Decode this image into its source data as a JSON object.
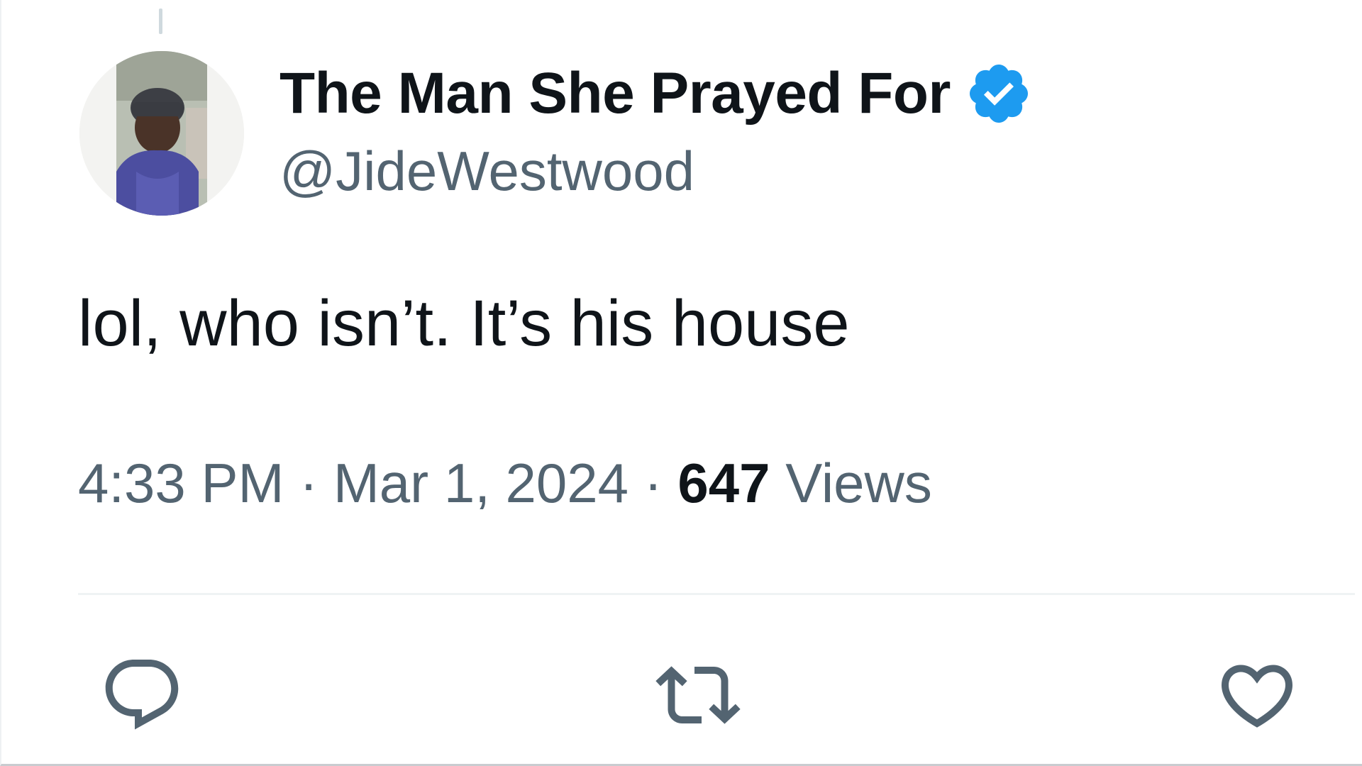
{
  "tweet": {
    "author": {
      "display_name": "The Man She Prayed For",
      "handle": "@JideWestwood",
      "verified": true,
      "verified_color": "#1d9bf0",
      "avatar_icon": "user-avatar-photo"
    },
    "text": "lol, who isn’t. It’s his house",
    "meta": {
      "time": "4:33 PM",
      "separator": " · ",
      "date": "Mar 1, 2024",
      "views_count": "647",
      "views_label": " Views"
    },
    "actions": [
      {
        "name": "reply",
        "icon": "reply-icon"
      },
      {
        "name": "retweet",
        "icon": "retweet-icon"
      },
      {
        "name": "like",
        "icon": "heart-icon"
      }
    ]
  },
  "colors": {
    "text_primary": "#0f1419",
    "text_secondary": "#536471",
    "accent": "#1d9bf0",
    "divider": "#eff3f4"
  }
}
